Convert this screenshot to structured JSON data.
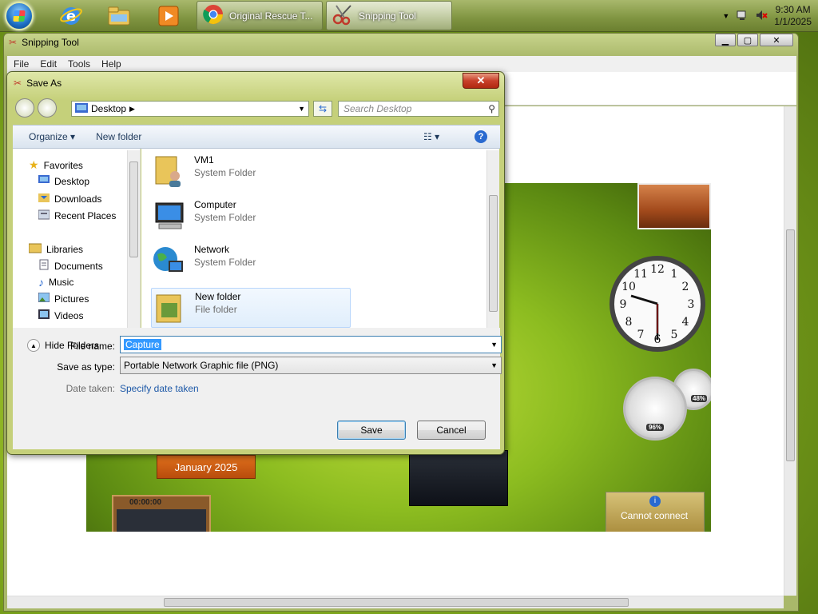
{
  "taskbar": {
    "windows": [
      {
        "label": "Original Rescue T...",
        "icon": "chrome-icon"
      },
      {
        "label": "Snipping Tool",
        "icon": "scissors-icon"
      }
    ],
    "clock": {
      "time": "9:30 AM",
      "date": "1/1/2025"
    }
  },
  "snipping_tool": {
    "title": "Snipping Tool",
    "menu": [
      "File",
      "Edit",
      "Tools",
      "Help"
    ]
  },
  "desktop_capture": {
    "calendar_label": "January 2025",
    "timer": "00:00:00",
    "meter_left": "96%",
    "meter_right": "48%",
    "weather_text": "Cannot connect"
  },
  "dialog": {
    "title": "Save As",
    "address": "Desktop",
    "search_placeholder": "Search Desktop",
    "organize_label": "Organize",
    "new_folder_label": "New folder",
    "nav": {
      "favorites": "Favorites",
      "favorites_items": [
        "Desktop",
        "Downloads",
        "Recent Places"
      ],
      "libraries": "Libraries",
      "libraries_items": [
        "Documents",
        "Music",
        "Pictures",
        "Videos"
      ]
    },
    "files": [
      {
        "name": "VM1",
        "type": "System Folder"
      },
      {
        "name": "Computer",
        "type": "System Folder"
      },
      {
        "name": "Network",
        "type": "System Folder"
      },
      {
        "name": "New folder",
        "type": "File folder"
      }
    ],
    "file_name_label": "File name:",
    "file_name_value": "Capture",
    "save_type_label": "Save as type:",
    "save_type_value": "Portable Network Graphic file (PNG)",
    "date_taken_label": "Date taken:",
    "date_taken_value": "Specify date taken",
    "hide_folders_label": "Hide Folders",
    "save_label": "Save",
    "cancel_label": "Cancel"
  }
}
